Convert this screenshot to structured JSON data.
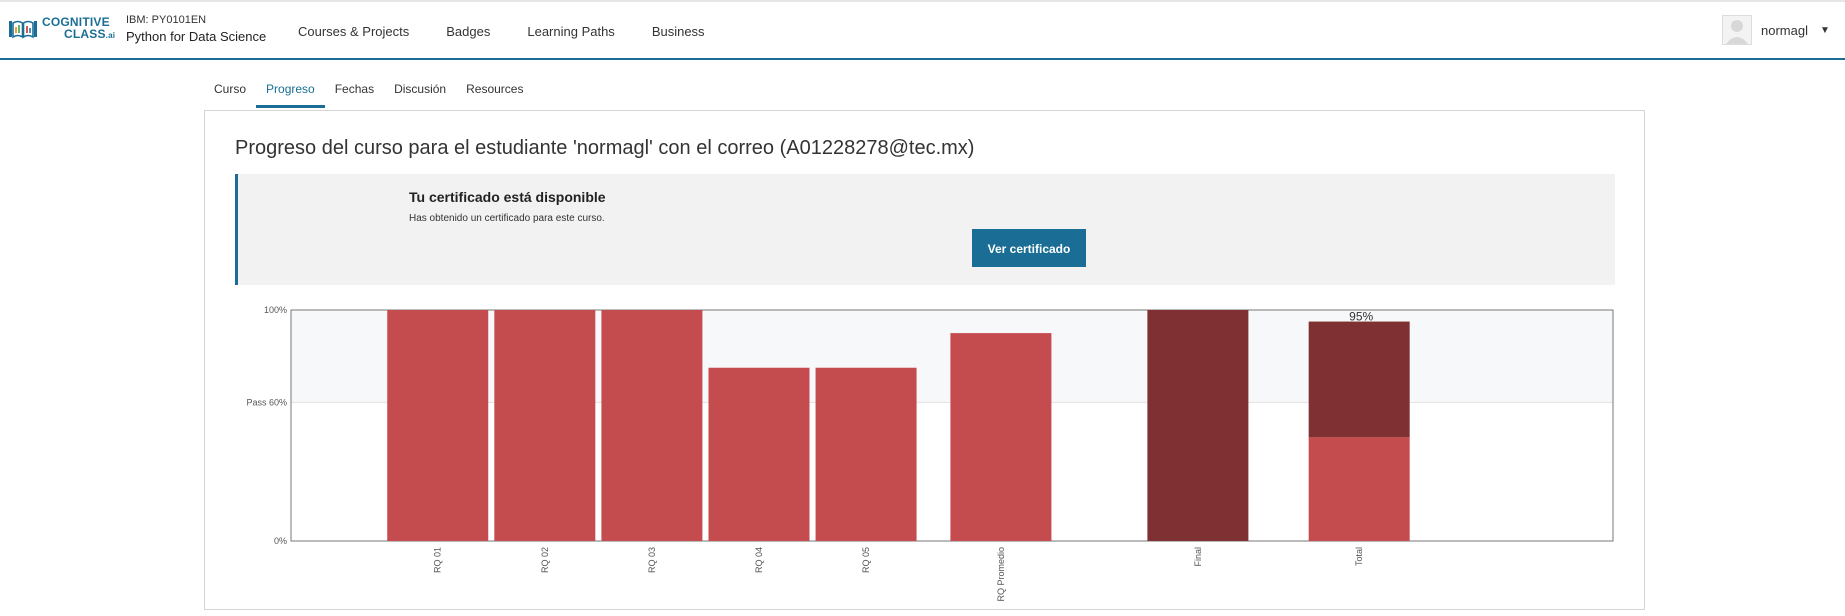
{
  "header": {
    "logo": {
      "line1": "COGNITIVE",
      "line2": "CLASS",
      "suffix": ".ai"
    },
    "course_id": "IBM: PY0101EN",
    "course_name": "Python for Data Science",
    "nav": [
      "Courses & Projects",
      "Badges",
      "Learning Paths",
      "Business"
    ],
    "user": {
      "name": "normagl",
      "icon": "user-avatar-icon"
    },
    "caret_icon": "caret-down-icon"
  },
  "tabs": [
    {
      "label": "Curso",
      "active": false
    },
    {
      "label": "Progreso",
      "active": true
    },
    {
      "label": "Fechas",
      "active": false
    },
    {
      "label": "Discusión",
      "active": false
    },
    {
      "label": "Resources",
      "active": false
    }
  ],
  "main": {
    "title": "Progreso del curso para el estudiante 'normagl' con el correo (A01228278@tec.mx)",
    "certificate": {
      "title": "Tu certificado está disponible",
      "text": "Has obtenido un certificado para este curso.",
      "button": "Ver certificado"
    }
  },
  "colors": {
    "accent": "#1a6e95",
    "bar": "#c44b4e",
    "bar_dark": "#7f3033"
  },
  "chart_data": {
    "type": "bar",
    "ylim": [
      0,
      100
    ],
    "yticks": [
      {
        "value": 0,
        "label": "0%"
      },
      {
        "value": 60,
        "label": "Pass 60%"
      },
      {
        "value": 100,
        "label": "100%"
      }
    ],
    "pass_threshold": 60,
    "categories": [
      "RQ 01",
      "RQ 02",
      "RQ 03",
      "RQ 04",
      "RQ 05",
      "RQ Promedio",
      "Final",
      "Total"
    ],
    "values": [
      100,
      100,
      100,
      75,
      75,
      90,
      100,
      95
    ],
    "total_breakdown": {
      "rq_part": 45,
      "final_part": 50
    },
    "data_labels": [
      {
        "category": "Total",
        "label": "95%"
      }
    ],
    "grid": false,
    "legend": "none"
  }
}
